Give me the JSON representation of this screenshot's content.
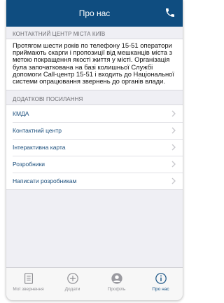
{
  "header": {
    "title": "Про нас"
  },
  "contact_center": {
    "heading": "КОНТАКТНИЙ ЦЕНТР МІСТА КИЇВ",
    "body": "Протягом шести років по телефону 15-51 оператори приймають скарги і пропозиції від мешканців міста з метою покращення якості життя у місті. Організація була започаткована на базі колишньої Службі допомоги Call-центр 15-51 і входить до Національної системи опрацювання звернень до органів влади."
  },
  "links": {
    "heading": "ДОДАТКОВІ ПОСИЛАННЯ",
    "items": [
      {
        "label": "КМДА"
      },
      {
        "label": "Контактний центр"
      },
      {
        "label": "Інтерактивна карта"
      },
      {
        "label": "Розробники"
      },
      {
        "label": "Написати розробникам"
      }
    ]
  },
  "tabbar": {
    "tabs": [
      {
        "label": "Мої звернення",
        "icon": "document-list-icon"
      },
      {
        "label": "Додати",
        "icon": "plus-circle-icon"
      },
      {
        "label": "Профіль",
        "icon": "profile-icon"
      },
      {
        "label": "Про нас",
        "icon": "info-icon"
      }
    ],
    "active": "Про нас"
  },
  "colors": {
    "navbar": "#0f4d80",
    "link": "#1a4e7c",
    "inactive_tab": "#8e8e93"
  }
}
